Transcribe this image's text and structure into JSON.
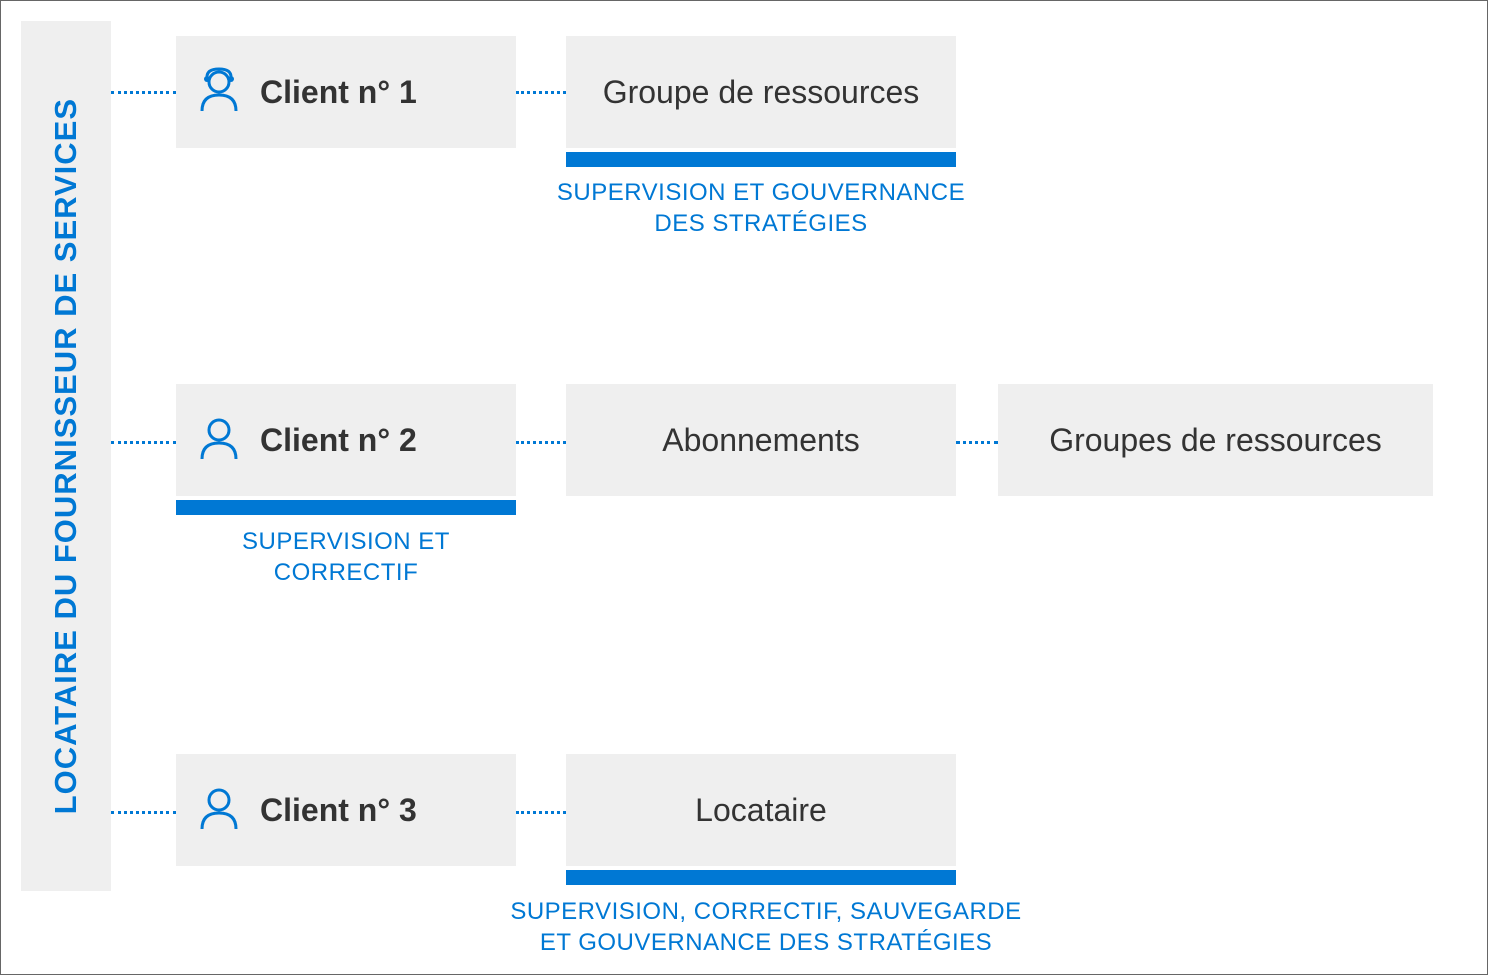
{
  "tenant_label": "LOCATAIRE DU FOURNISSEUR DE SERVICES",
  "row1": {
    "client": "Client n° 1",
    "node1": "Groupe de ressources",
    "caption_line1": "SUPERVISION ET GOUVERNANCE",
    "caption_line2": "DES STRATÉGIES"
  },
  "row2": {
    "client": "Client n° 2",
    "node1": "Abonnements",
    "node2": "Groupes de ressources",
    "caption": "SUPERVISION ET CORRECTIF"
  },
  "row3": {
    "client": "Client n° 3",
    "node1": "Locataire",
    "caption_line1": "SUPERVISION, CORRECTIF, SAUVEGARDE",
    "caption_line2": "ET GOUVERNANCE DES STRATÉGIES"
  }
}
